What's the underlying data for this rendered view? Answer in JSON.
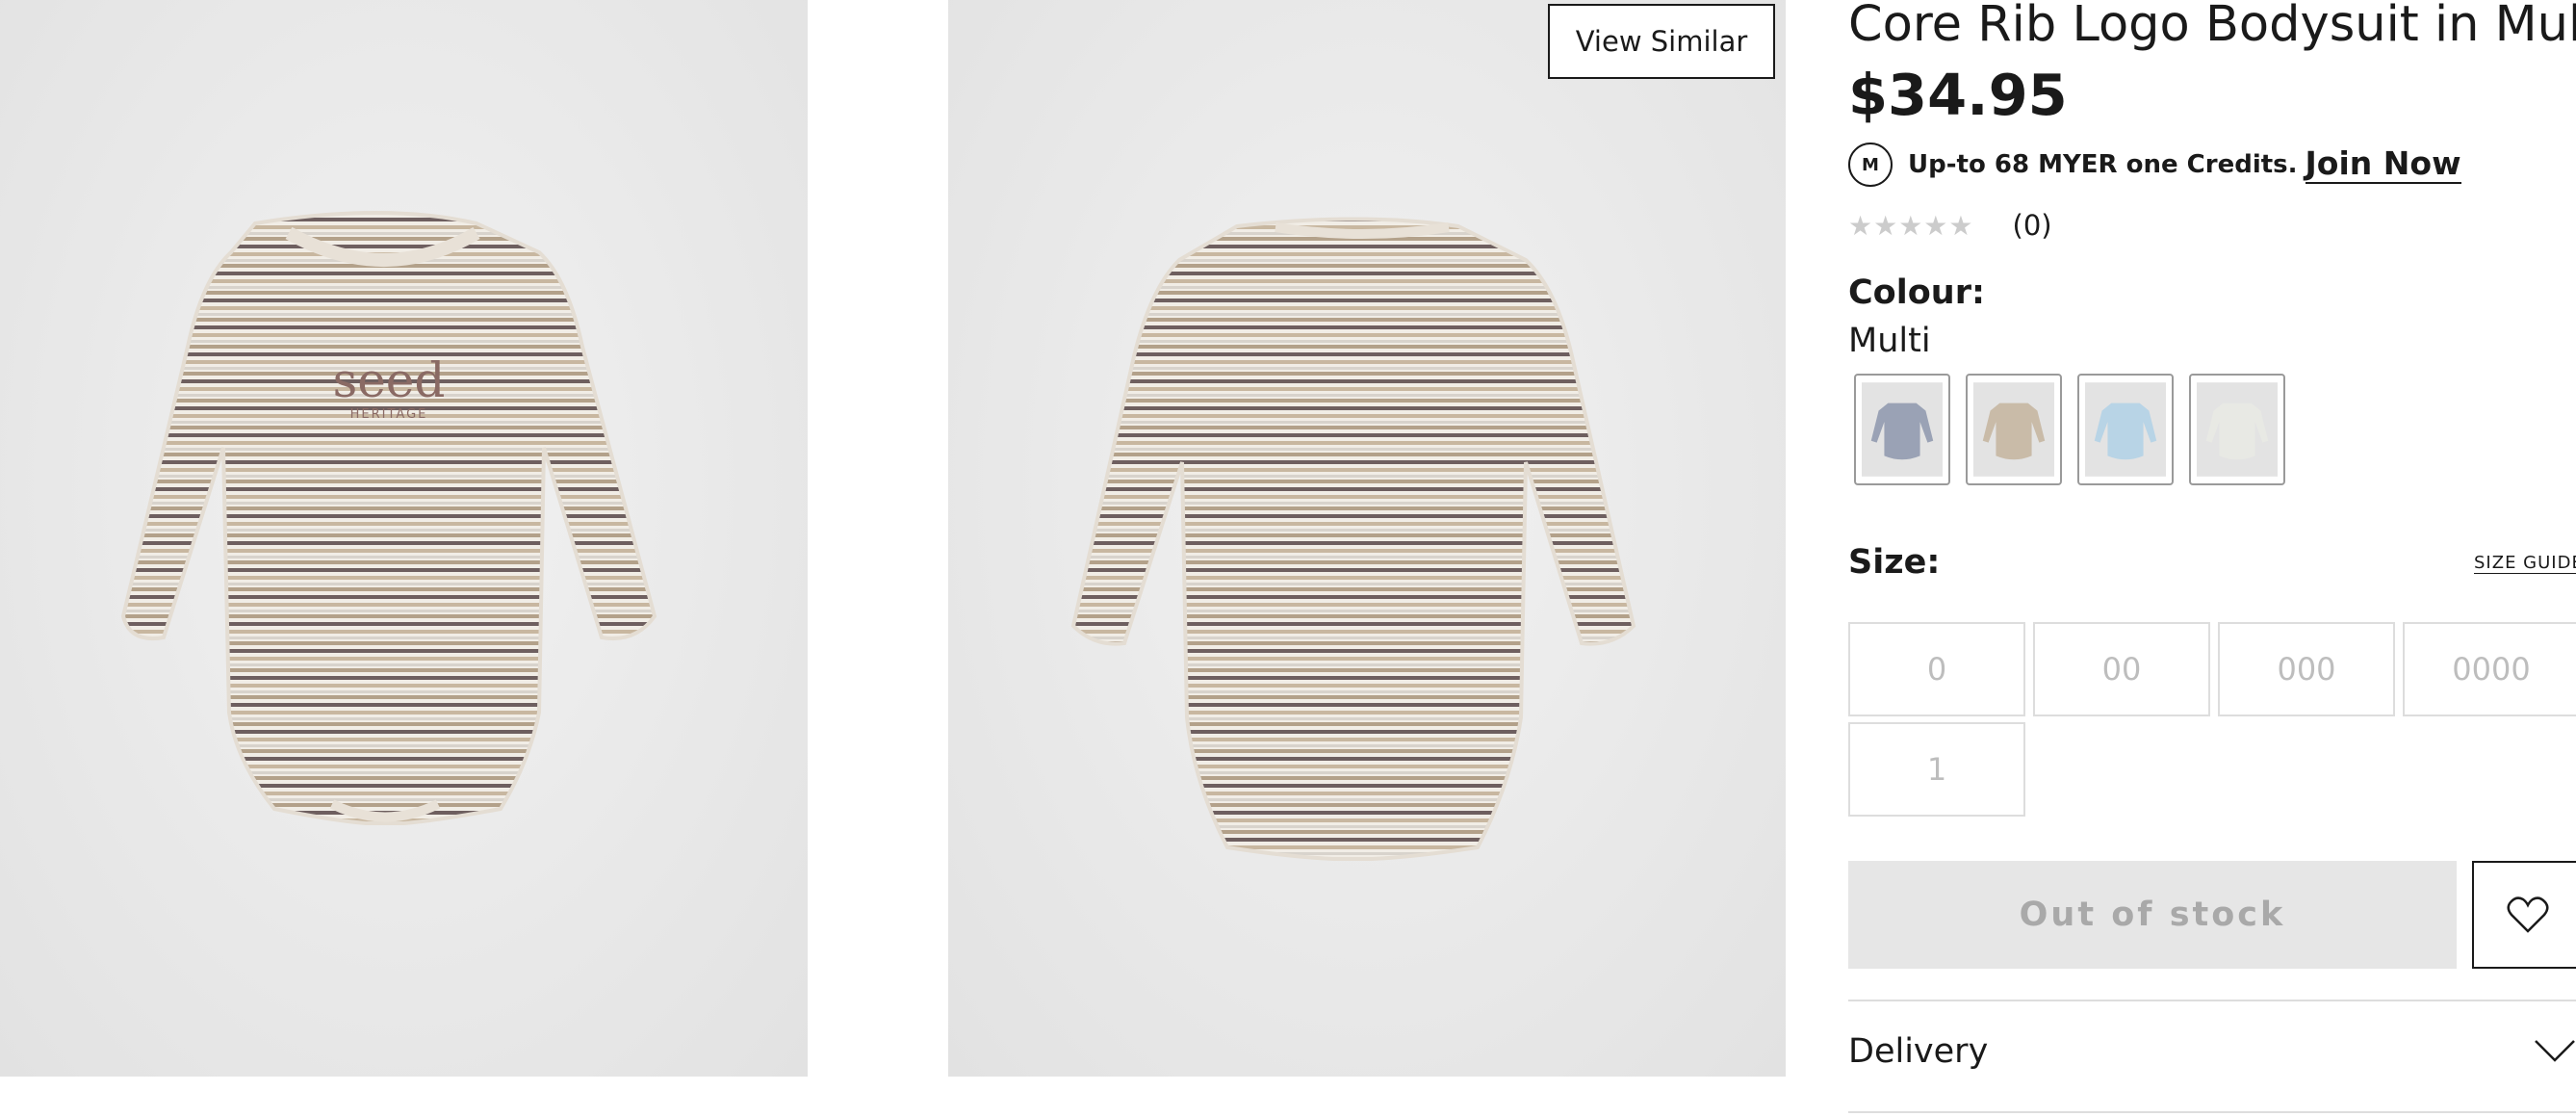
{
  "gallery": {
    "view_similar_label": "View Similar",
    "image_1_print": "seed",
    "image_1_subprint": "HERITAGE"
  },
  "product": {
    "title": "Core Rib Logo Bodysuit in Multi",
    "price": "$34.95",
    "myer_badge": "M",
    "credits_text": "Up-to 68 MYER one Credits.",
    "join_now_label": "Join Now",
    "rating_stars": "★★★★★",
    "rating_count": "(0)"
  },
  "colour": {
    "label": "Colour:",
    "selected": "Multi",
    "swatch_colors": [
      "#9aa2b5",
      "#c9bba8",
      "#b8d4e6",
      "#e8e9e4"
    ]
  },
  "size": {
    "label": "Size:",
    "guide_label": "SIZE GUIDE",
    "options": [
      "0",
      "00",
      "000",
      "0000",
      "1"
    ]
  },
  "actions": {
    "out_of_stock_label": "Out of stock",
    "wishlist_icon": "heart-icon"
  },
  "delivery": {
    "label": "Delivery",
    "icon": "chevron-down-icon"
  }
}
